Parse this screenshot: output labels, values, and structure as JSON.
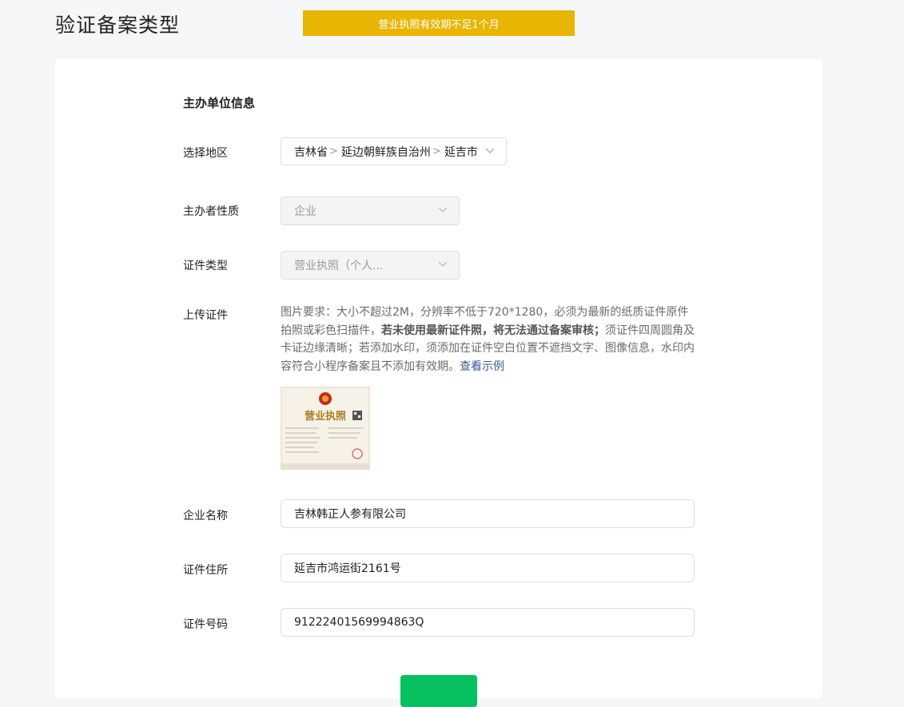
{
  "header": {
    "title": "验证备案类型",
    "warning": "营业执照有效期不足1个月"
  },
  "form": {
    "section_title": "主办单位信息",
    "region": {
      "label": "选择地区",
      "province": "吉林省",
      "prefecture": "延边朝鲜族自治州",
      "city": "延吉市"
    },
    "organizer_type": {
      "label": "主办者性质",
      "value": "企业"
    },
    "cert_type": {
      "label": "证件类型",
      "value": "营业执照（个人..."
    },
    "upload": {
      "label": "上传证件",
      "desc_part1": "图片要求：大小不超过2M，分辨率不低于720*1280，必须为最新的纸质证件原件拍照或彩色扫描件，",
      "desc_bold": "若未使用最新证件照，将无法通过备案审核；",
      "desc_part2": "须证件四周圆角及卡证边缘清晰；若添加水印，须添加在证件空白位置不遮挡文字、图像信息，水印内容符合小程序备案且不添加有效期。",
      "example_link": "查看示例",
      "image_title": "营业执照"
    },
    "company_name": {
      "label": "企业名称",
      "value": "吉林韩正人参有限公司"
    },
    "cert_address": {
      "label": "证件住所",
      "value": "延吉市鸿运街2161号"
    },
    "cert_number": {
      "label": "证件号码",
      "value": "91222401569994863Q"
    }
  },
  "colors": {
    "warning_bg": "#e9b504",
    "primary_green": "#07c160",
    "link": "#3a5a97"
  }
}
